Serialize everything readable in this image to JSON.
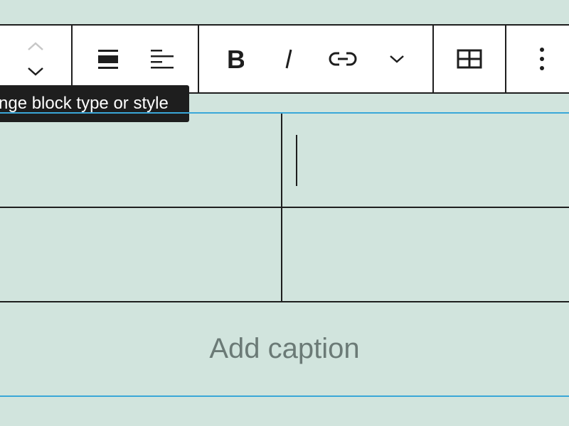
{
  "tooltip": {
    "text": "nge block type or style"
  },
  "table": {
    "caption_placeholder": "Add caption"
  },
  "toolbar": {
    "buttons": [
      {
        "name": "move-up",
        "icon": "chevron-up-icon"
      },
      {
        "name": "move-down",
        "icon": "chevron-down-icon"
      },
      {
        "name": "change-alignment",
        "icon": "align-wide-icon"
      },
      {
        "name": "change-text-alignment",
        "icon": "align-left-icon"
      },
      {
        "name": "bold",
        "icon": "bold-icon"
      },
      {
        "name": "italic",
        "icon": "italic-icon"
      },
      {
        "name": "link",
        "icon": "link-icon"
      },
      {
        "name": "more-rich-text",
        "icon": "chevron-down-icon"
      },
      {
        "name": "edit-table",
        "icon": "table-icon"
      },
      {
        "name": "options",
        "icon": "more-vertical-icon"
      }
    ]
  },
  "colors": {
    "background": "#d1e4dd",
    "toolbar_border": "#1e1e1e",
    "tooltip_bg": "#1e1e1e",
    "selection_outline": "#3aa7d8",
    "placeholder_text": "#6b7a76"
  }
}
